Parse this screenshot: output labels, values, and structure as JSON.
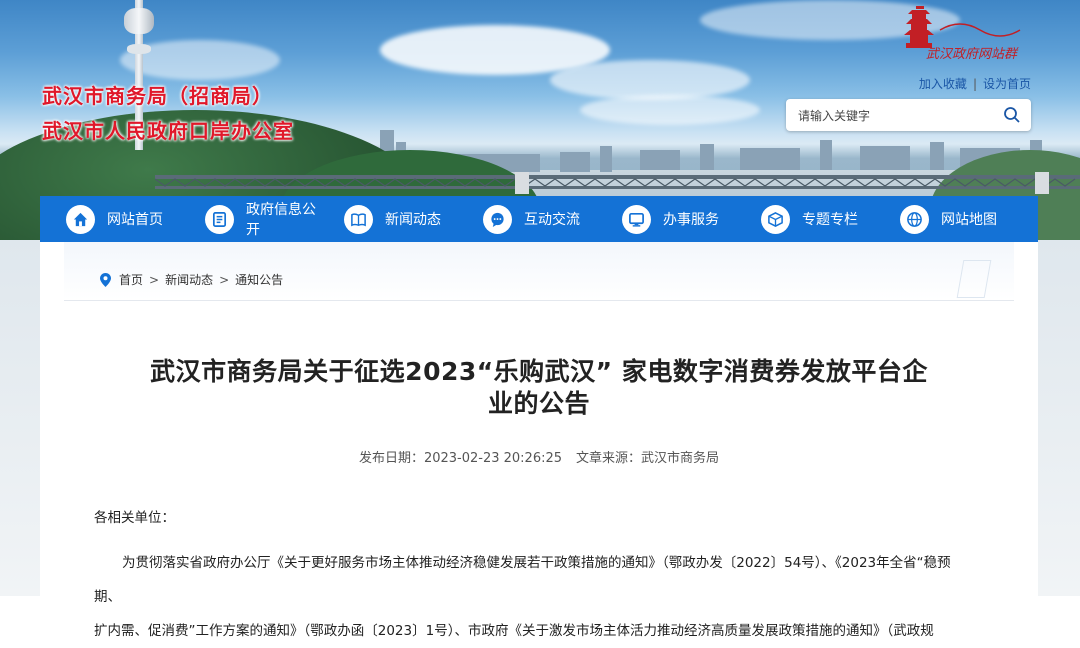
{
  "header": {
    "org_name_1": "武汉市商务局（招商局）",
    "org_name_2": "武汉市人民政府口岸办公室",
    "logo_text": "武汉政府网站群",
    "add_favorite": "加入收藏",
    "separator": "|",
    "set_homepage": "设为首页",
    "search": {
      "placeholder": "请输入关键字",
      "icon": "search-icon"
    }
  },
  "nav": {
    "items": [
      {
        "label": "网站首页",
        "icon": "home-icon"
      },
      {
        "label": "政府信息公开",
        "icon": "document-icon"
      },
      {
        "label": "新闻动态",
        "icon": "book-icon"
      },
      {
        "label": "互动交流",
        "icon": "chat-icon"
      },
      {
        "label": "办事服务",
        "icon": "monitor-icon"
      },
      {
        "label": "专题专栏",
        "icon": "cube-icon"
      },
      {
        "label": "网站地图",
        "icon": "globe-icon"
      }
    ],
    "color": "#1472d6"
  },
  "breadcrumb": {
    "icon": "location-pin-icon",
    "items": [
      "首页",
      "新闻动态",
      "通知公告"
    ],
    "separator": ">"
  },
  "article": {
    "title_line1": "武汉市商务局关于征选2023“乐购武汉” 家电数字消费券发放平台企",
    "title_line2": "业的公告",
    "publish_label": "发布日期：",
    "publish_date": "2023-02-23 20:26:25",
    "source_label": "文章来源：",
    "source": "武汉市商务局",
    "greeting": "各相关单位：",
    "paragraph_line1": "为贯彻落实省政府办公厅《关于更好服务市场主体推动经济稳健发展若干政策措施的通知》（鄂政办发〔2022〕54号）、《2023年全省“稳预期、",
    "paragraph_line2": "扩内需、促消费”工作方案的通知》（鄂政办函〔2023〕1号）、市政府《关于激发市场主体活力推动经济高质量发展政策措施的通知》（武政规"
  },
  "colors": {
    "org_name": "#e0182a",
    "link": "#1a56a6",
    "nav_bg": "#1472d6"
  }
}
